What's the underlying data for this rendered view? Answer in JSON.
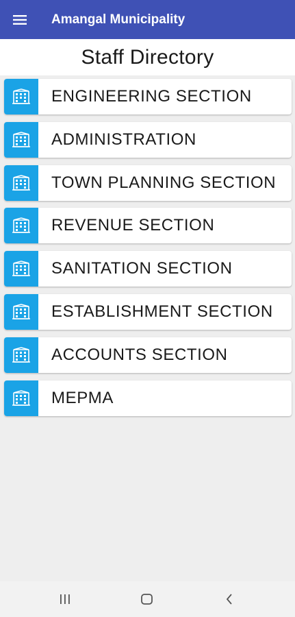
{
  "app_bar": {
    "title": "Amangal Municipality",
    "menu_icon": "hamburger-menu-icon",
    "color": "#3f51b5"
  },
  "page": {
    "heading": "Staff Directory"
  },
  "sections": [
    {
      "label": "ENGINEERING SECTION",
      "icon": "building-icon"
    },
    {
      "label": "ADMINISTRATION",
      "icon": "building-icon"
    },
    {
      "label": "TOWN PLANNING SECTION",
      "icon": "building-icon"
    },
    {
      "label": "REVENUE SECTION",
      "icon": "building-icon"
    },
    {
      "label": "SANITATION SECTION",
      "icon": "building-icon"
    },
    {
      "label": "ESTABLISHMENT SECTION",
      "icon": "building-icon"
    },
    {
      "label": "ACCOUNTS SECTION",
      "icon": "building-icon"
    },
    {
      "label": "MEPMA",
      "icon": "building-icon"
    }
  ],
  "icon_color": "#1aa3e6",
  "nav_bar": {
    "recents_icon": "recents-icon",
    "home_icon": "home-icon",
    "back_icon": "back-icon"
  }
}
